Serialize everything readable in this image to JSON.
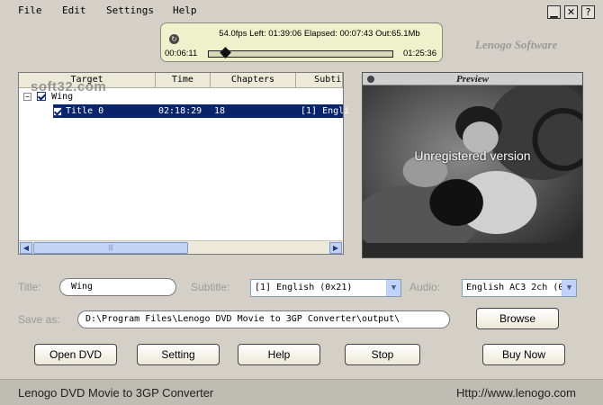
{
  "menu": [
    "File",
    "Edit",
    "Settings",
    "Help"
  ],
  "window_controls": {
    "minimize": "▁",
    "close": "✕",
    "help": "?"
  },
  "status": {
    "fps": "54.0fps",
    "left": "Left: 01:39:06",
    "elapsed": "Elapsed: 00:07:43",
    "out": "Out:65.1Mb",
    "time_start": "00:06:11",
    "time_end": "01:25:36",
    "progress": 0.07
  },
  "brand": "Lenogo Software",
  "table": {
    "columns": [
      "Target",
      "Time",
      "Chapters",
      "Subti"
    ],
    "tree_root": "Wing",
    "rows": [
      {
        "title": "Title 0",
        "time": "02:18:29",
        "chapters": "18",
        "subtitle": "[1] Engli"
      }
    ]
  },
  "watermark": "soft32.com",
  "preview": {
    "title": "Preview",
    "overlay": "Unregistered version"
  },
  "form": {
    "title_label": "Title:",
    "title_value": "Wing",
    "subtitle_label": "Subtitle:",
    "subtitle_value": "[1] English (0x21)",
    "audio_label": "Audio:",
    "audio_value": "English AC3 2ch (0:",
    "saveas_label": "Save as:",
    "saveas_value": "D:\\Program Files\\Lenogo DVD Movie to 3GP Converter\\output\\",
    "browse_label": "Browse"
  },
  "buttons": {
    "open_dvd": "Open DVD",
    "setting": "Setting",
    "help": "Help",
    "stop": "Stop",
    "buy_now": "Buy Now"
  },
  "footer": {
    "app_name": "Lenogo DVD Movie to 3GP Converter",
    "url": "Http://www.lenogo.com"
  }
}
